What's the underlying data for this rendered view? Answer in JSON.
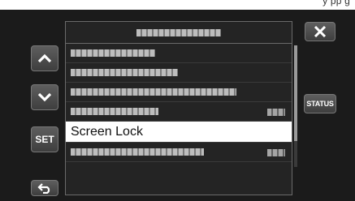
{
  "page_top_text": "y pp g",
  "menu": {
    "title_obscured": true,
    "items": [
      {
        "label": "",
        "obscured": true
      },
      {
        "label": "",
        "obscured": true
      },
      {
        "label": "",
        "obscured": true
      },
      {
        "label": "",
        "obscured": true,
        "has_value": true
      },
      {
        "label": "Screen Lock",
        "obscured": false,
        "selected": true
      },
      {
        "label": "",
        "obscured": true,
        "has_value": true
      }
    ]
  },
  "buttons": {
    "up": {
      "icon": "chevron-up-icon"
    },
    "down": {
      "icon": "chevron-down-icon"
    },
    "set": {
      "label": "SET"
    },
    "back": {
      "icon": "back-arrow-icon"
    },
    "close": {
      "icon": "close-icon"
    },
    "status": {
      "label": "STATUS"
    }
  },
  "colors": {
    "screen_bg": "#1b1b1b",
    "button_bg": "#4e4e4e",
    "selected_row_bg": "#ffffff",
    "text": "#ffffff"
  }
}
